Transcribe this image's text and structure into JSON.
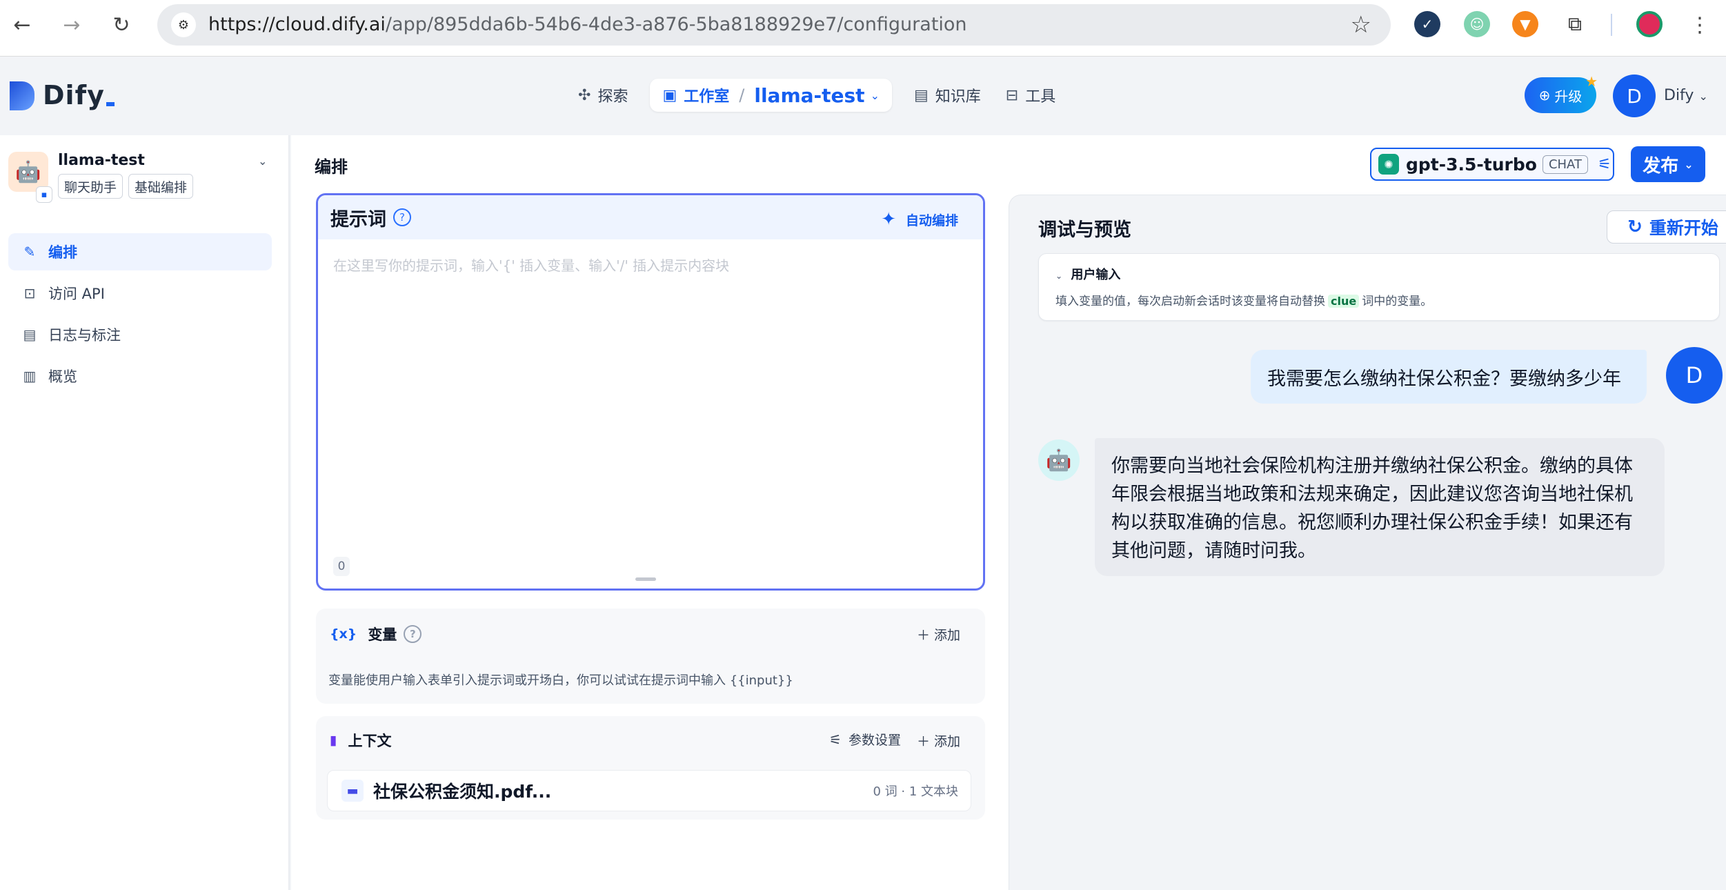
{
  "browser": {
    "url_host": "https://cloud.dify.ai",
    "url_path": "/app/895dda6b-54b6-4de3-a876-5ba8188929e7/configuration"
  },
  "header": {
    "logo_text": "Dify",
    "nav": {
      "explore": "探索",
      "studio": "工作室",
      "app_name": "llama-test",
      "knowledge": "知识库",
      "tools": "工具"
    },
    "upgrade_label": "升级",
    "avatar_initial": "D",
    "user_name": "Dify"
  },
  "sidebar": {
    "app_name": "llama-test",
    "tags": [
      "聊天助手",
      "基础编排"
    ],
    "items": [
      {
        "label": "编排",
        "icon": "orchestrate-icon",
        "active": true
      },
      {
        "label": "访问 API",
        "icon": "terminal-icon",
        "active": false
      },
      {
        "label": "日志与标注",
        "icon": "log-icon",
        "active": false
      },
      {
        "label": "概览",
        "icon": "chart-icon",
        "active": false
      }
    ]
  },
  "main": {
    "title": "编排",
    "model": {
      "name": "gpt-3.5-turbo",
      "mode": "CHAT"
    },
    "publish_label": "发布",
    "prompt": {
      "title": "提示词",
      "auto_edit": "自动编排",
      "placeholder": "在这里写你的提示词，输入'{' 插入变量、输入'/' 插入提示内容块",
      "count": "0"
    },
    "variables": {
      "title": "变量",
      "add": "添加",
      "desc": "变量能使用户输入表单引入提示词或开场白，你可以试试在提示词中输入 {{input}}"
    },
    "context": {
      "title": "上下文",
      "params": "参数设置",
      "add": "添加",
      "doc_name": "社保公积金须知.pdf...",
      "doc_meta": "0 词 · 1 文本块"
    }
  },
  "debug": {
    "title": "调试与预览",
    "restart": "重新开始",
    "user_input_title": "用户输入",
    "user_input_desc_before": "填入变量的值，每次启动新会话时该变量将自动替换",
    "user_input_clue": "clue",
    "user_input_desc_after": "词中的变量。",
    "user_message": "我需要怎么缴纳社保公积金？要缴纳多少年",
    "user_avatar": "D",
    "bot_message": "你需要向当地社会保险机构注册并缴纳社保公积金。缴纳的具体年限会根据当地政策和法规来确定，因此建议您咨询当地社保机构以获取准确的信息。祝您顺利办理社保公积金手续！如果还有其他问题，请随时问我。"
  },
  "colors": {
    "accent": "#155eef",
    "prompt_border": "#6172f3"
  }
}
